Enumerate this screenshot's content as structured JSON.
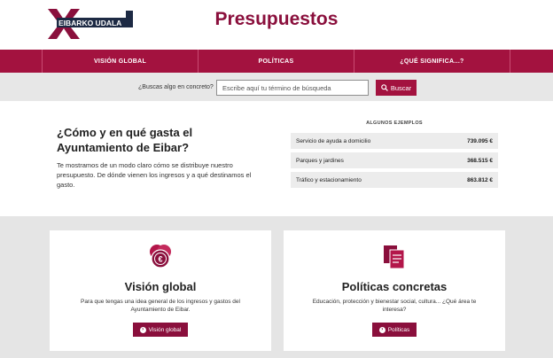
{
  "header": {
    "logo_text": "EIBARKO UDALA",
    "title": "Presupuestos"
  },
  "nav": {
    "items": [
      {
        "label": "VISIÓN GLOBAL"
      },
      {
        "label": "POLÍTICAS"
      },
      {
        "label": "¿QUÉ SIGNIFICA...?"
      }
    ]
  },
  "search": {
    "label": "¿Buscas algo en concreto?",
    "placeholder": "Escribe aquí tu término de búsqueda",
    "button": "Buscar"
  },
  "intro": {
    "title": "¿Cómo y en qué gasta el Ayuntamiento de Eibar?",
    "text": "Te mostramos de un modo claro cómo se distribuye nuestro presupuesto. De dónde vienen los ingresos y a qué destinamos el gasto."
  },
  "examples": {
    "title": "ALGUNOS EJEMPLOS",
    "rows": [
      {
        "label": "Servicio de ayuda a domicilio",
        "value": "739.095 €"
      },
      {
        "label": "Parques y jardines",
        "value": "368.515 €"
      },
      {
        "label": "Tráfico y estacionamiento",
        "value": "863.812 €"
      }
    ]
  },
  "cards": [
    {
      "title": "Visión global",
      "desc": "Para que tengas una idea general de los ingresos y gastos del Ayuntamiento de Eibar.",
      "button": "Visión global",
      "icon": "euro-coins-icon"
    },
    {
      "title": "Políticas concretas",
      "desc": "Educación, protección y bienestar social, cultura... ¿Qué área te interesa?",
      "button": "Políticas",
      "icon": "documents-icon"
    }
  ],
  "colors": {
    "brand": "#a3123f",
    "brand_dark": "#8a0f3c",
    "bg_gray": "#e5e5e5"
  }
}
